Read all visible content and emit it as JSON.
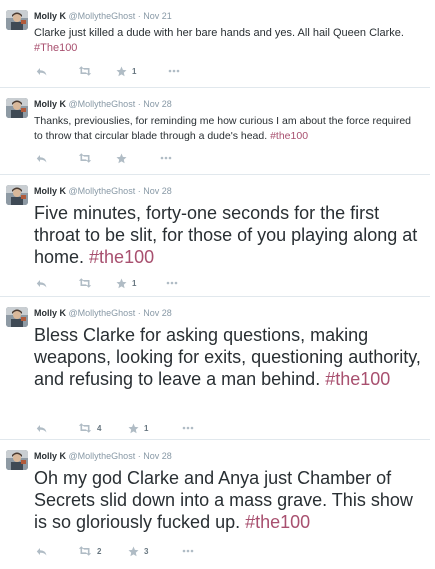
{
  "tweets": [
    {
      "name": "Molly K",
      "handle": "@MollytheGhost",
      "separator": "·",
      "time": "Nov 21",
      "text_before": "Clarke just killed a dude with her bare hands and yes. All hail Queen Clarke. ",
      "hashtag": "#The100",
      "retweet_count": "",
      "favorite_count": "1"
    },
    {
      "name": "Molly K",
      "handle": "@MollytheGhost",
      "separator": "·",
      "time": "Nov 28",
      "text_before": "Thanks, previouslies, for reminding me how curious I am about the force required to throw that circular blade through a dude's head. ",
      "hashtag": "#the100",
      "retweet_count": "",
      "favorite_count": ""
    },
    {
      "name": "Molly K",
      "handle": "@MollytheGhost",
      "separator": "·",
      "time": "Nov 28",
      "text_before": "Five minutes, forty-one seconds for the first throat to be slit, for those of you playing along at home. ",
      "hashtag": "#the100",
      "retweet_count": "",
      "favorite_count": "1"
    },
    {
      "name": "Molly K",
      "handle": "@MollytheGhost",
      "separator": "·",
      "time": "Nov 28",
      "text_before": "Bless Clarke for asking questions, making weapons, looking for exits, questioning authority, and refusing to leave a man behind. ",
      "hashtag": "#the100",
      "retweet_count": "4",
      "favorite_count": "1"
    },
    {
      "name": "Molly K",
      "handle": "@MollytheGhost",
      "separator": "·",
      "time": "Nov 28",
      "text_before": "Oh my god Clarke and Anya just Chamber of Secrets slid down into a mass grave. This show is so gloriously fucked up. ",
      "hashtag": "#the100",
      "retweet_count": "2",
      "favorite_count": "3"
    }
  ],
  "icons": {
    "reply": "reply-icon",
    "retweet": "retweet-icon",
    "favorite": "star-icon",
    "more": "more-icon"
  },
  "colors": {
    "hashtag": "#a8506f",
    "meta": "#8899a6",
    "text": "#292f33"
  }
}
